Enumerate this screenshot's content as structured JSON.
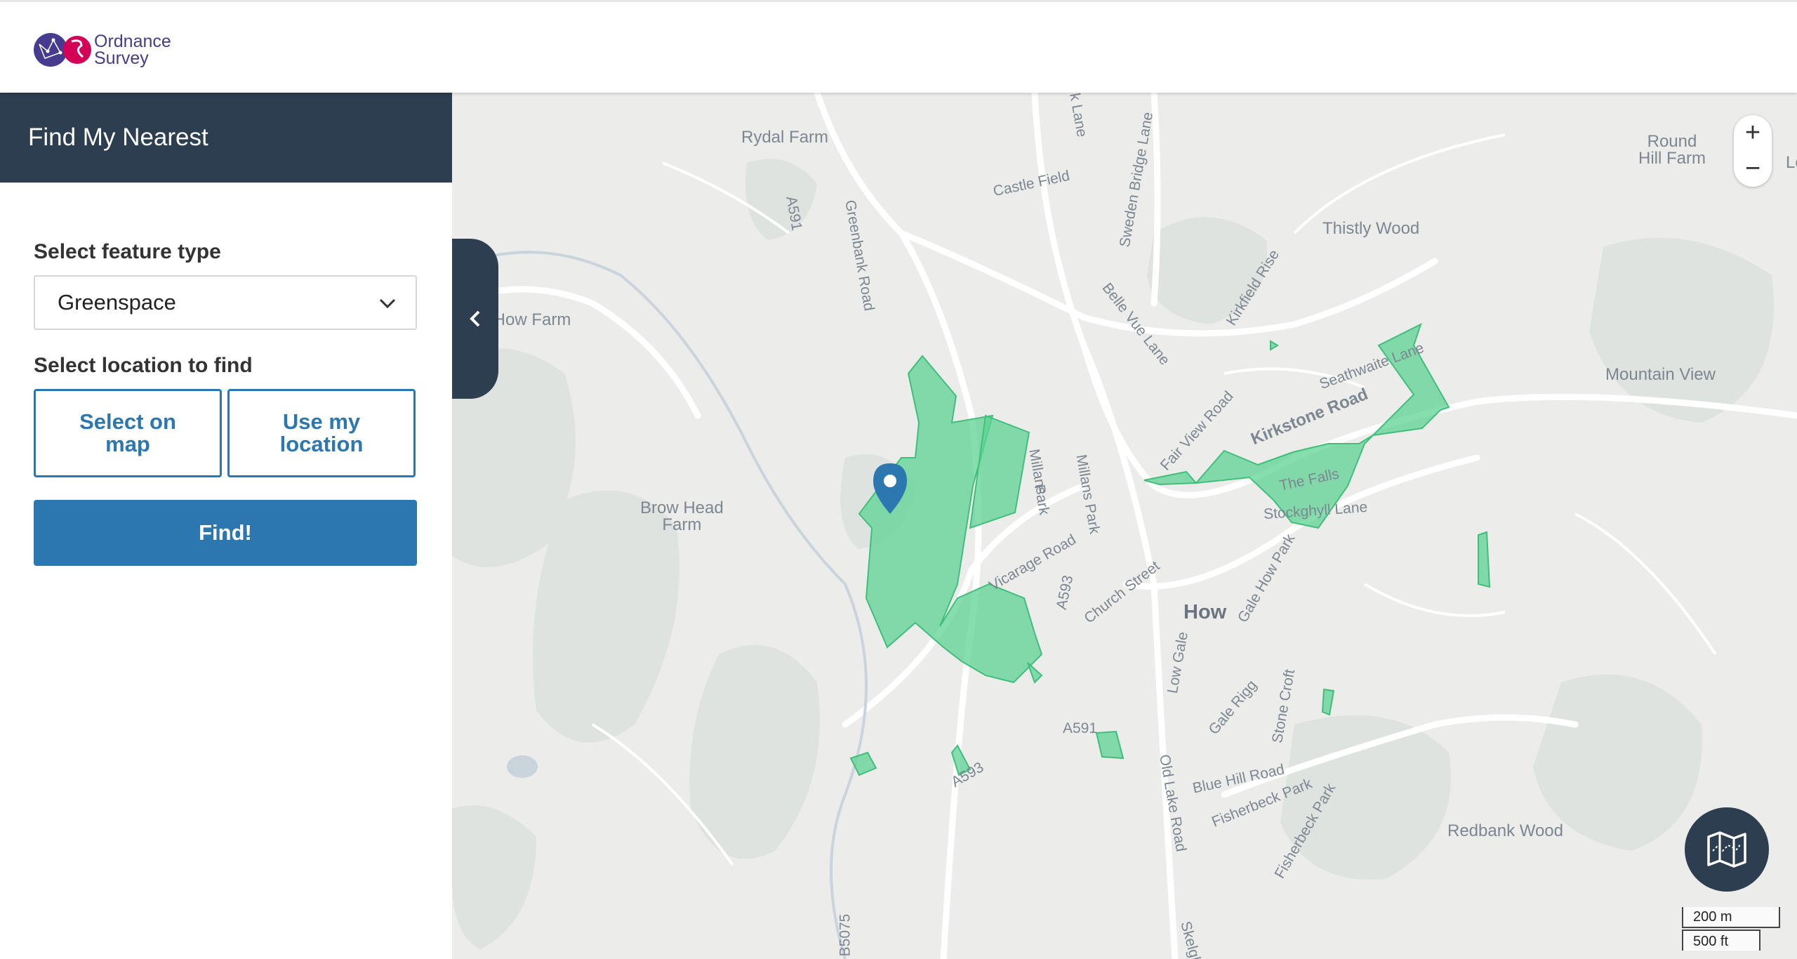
{
  "header": {
    "logo_line1": "Ordnance",
    "logo_line2": "Survey",
    "logo_icon": "ordnance-survey-logo"
  },
  "sidebar": {
    "title": "Find My Nearest",
    "feature_label": "Select feature type",
    "feature_selected": "Greenspace",
    "location_label": "Select location to find",
    "select_on_map": "Select on map",
    "use_my_location": "Use my location",
    "find_button": "Find!",
    "collapse_icon": "chevron-left-icon"
  },
  "map": {
    "labels": {
      "rydal_farm": "Rydal Farm",
      "castle_field": "Castle Field",
      "a591_top": "A591",
      "greenbank_road": "Greenbank Road",
      "sweden_bridge_lane": "Sweden Bridge Lane",
      "thistly_wood": "Thistly Wood",
      "round_hill_farm_1": "Round",
      "round_hill_farm_2": "Hill Farm",
      "how_farm": "x How Farm",
      "kirkfield_rise": "Kirkfield Rise",
      "belle_vue_lane": "Belle Vue Lane",
      "seathwaite_lane": "Seathwaite Lane",
      "mountain_view": "Mountain View",
      "kirkstone_road": "Kirkstone Road",
      "fair_view_road": "Fair View Road",
      "millans_park_1": "Millans",
      "millans_park_2": "Park",
      "millans_park_3": "Millans Park",
      "the_falls": "The Falls",
      "stockghyll_lane": "Stockghyll Lane",
      "brow_head_farm_1": "Brow Head",
      "brow_head_farm_2": "Farm",
      "vicarage_road": "Vicarage Road",
      "a593_mid": "A593",
      "church_street": "Church Street",
      "how": "How",
      "gale_how_park": "Gale How Park",
      "low_gale": "Low Gale",
      "gale_rigg": "Gale Rigg",
      "stone_croft": "Stone Croft",
      "a591_bottom": "A591",
      "a593_bottom": "A593",
      "blue_hill_road": "Blue Hill Road",
      "old_lake_road": "Old Lake Road",
      "fisherbeck_park": "Fisherbeck Park",
      "fisherbeck_park_2": "Fisherbeck Park",
      "redbank_wood": "Redbank Wood",
      "b5075": "B5075",
      "edge_le": "Le",
      "lane_top": "k Lane",
      "skelghyll": "Skelgh"
    },
    "zoom_in": "+",
    "zoom_out": "−",
    "scale_m": "200 m",
    "scale_ft": "500 ft",
    "greenspace_color": "#5ed394",
    "marker_color": "#2c77b0",
    "basemap_icon": "map-icon"
  }
}
